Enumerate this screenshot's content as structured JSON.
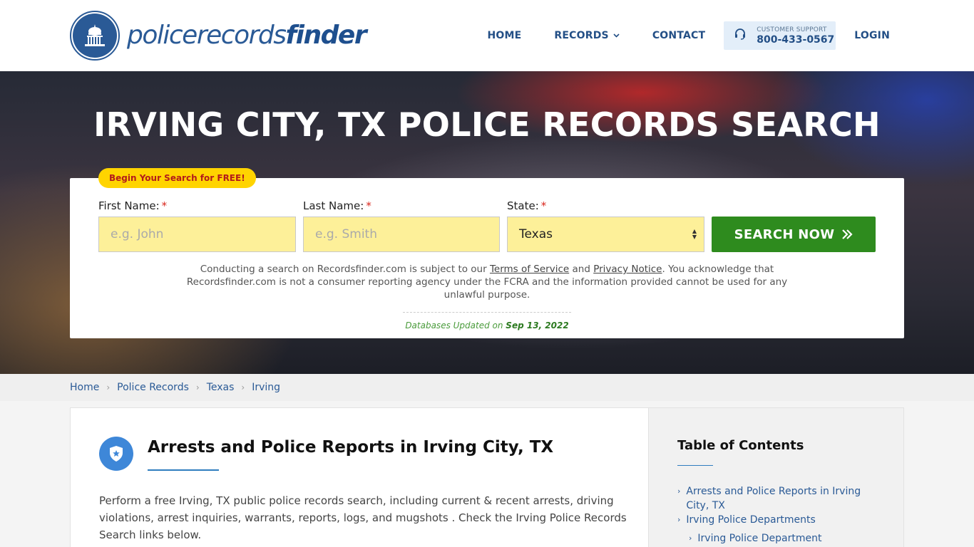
{
  "header": {
    "logo_light": "policerecords",
    "logo_bold": "finder",
    "nav": [
      {
        "label": "HOME"
      },
      {
        "label": "RECORDS"
      },
      {
        "label": "CONTACT"
      }
    ],
    "support_label": "CUSTOMER SUPPORT",
    "support_phone": "800-433-0567",
    "login_label": "LOGIN"
  },
  "hero": {
    "title": "IRVING CITY, TX POLICE RECORDS SEARCH",
    "badge": "Begin Your Search for FREE!",
    "first_name_label": "First Name:",
    "first_name_placeholder": "e.g. John",
    "last_name_label": "Last Name:",
    "last_name_placeholder": "e.g. Smith",
    "state_label": "State:",
    "state_value": "Texas",
    "required_mark": "*",
    "search_button": "SEARCH NOW",
    "disclaimer_1": "Conducting a search on Recordsfinder.com is subject to our ",
    "terms_link": "Terms of Service",
    "disclaimer_2": " and ",
    "privacy_link": "Privacy Notice",
    "disclaimer_3": ". You acknowledge that Recordsfinder.com is not a consumer reporting agency under the FCRA and the information provided cannot be used for any unlawful purpose.",
    "db_updated_label": "Databases Updated on ",
    "db_updated_date": "Sep 13, 2022"
  },
  "breadcrumb": [
    "Home",
    "Police Records",
    "Texas",
    "Irving"
  ],
  "article": {
    "title": "Arrests and Police Reports in Irving City, TX",
    "body": "Perform a free Irving, TX public police records search, including current & recent arrests, driving violations, arrest inquiries, warrants, reports, logs, and mugshots . Check the Irving Police Records Search links below."
  },
  "toc": {
    "title": "Table of Contents",
    "items": [
      "Arrests and Police Reports in Irving City, TX",
      "Irving Police Departments",
      "Irving Police Department"
    ]
  },
  "colors": {
    "brand_blue": "#2a5a96",
    "search_green": "#2e8b1e",
    "input_yellow": "#fdf099",
    "badge_yellow": "#ffd400"
  },
  "icons": [
    "capitol-logo-icon",
    "headset-icon",
    "chevron-down-icon",
    "double-chevron-right-icon",
    "police-badge-icon",
    "chevron-right-icon"
  ]
}
